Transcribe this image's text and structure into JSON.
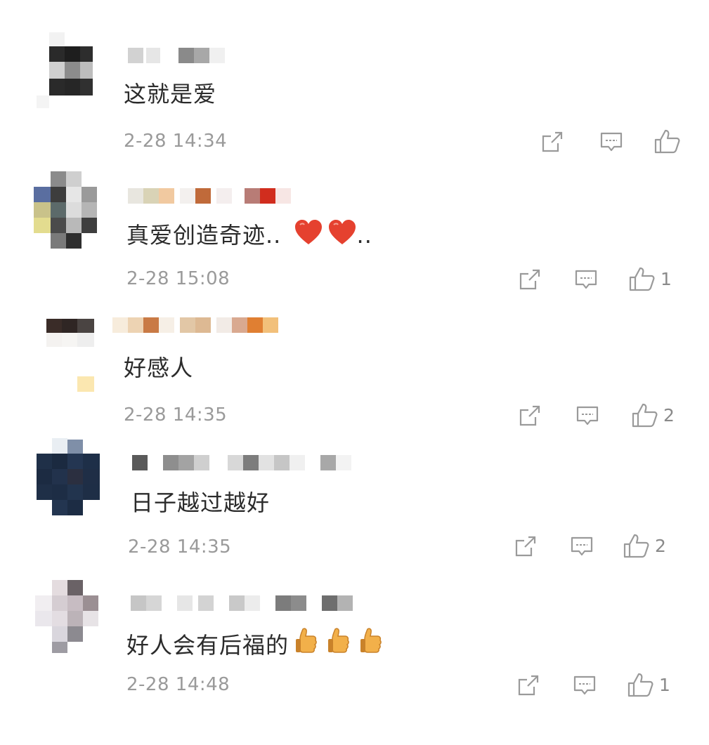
{
  "comments": [
    {
      "text": "这就是爱",
      "time": "2-28 14:34",
      "likes": "",
      "emoji": "",
      "emoji_count": 0
    },
    {
      "text": "真爱创造奇迹.. ",
      "time": "2-28 15:08",
      "likes": "1",
      "emoji": "red-heart",
      "emoji_count": 2,
      "suffix": ".."
    },
    {
      "text": "好感人",
      "time": "2-28 14:35",
      "likes": "2",
      "emoji": "",
      "emoji_count": 0
    },
    {
      "text": "日子越过越好",
      "time": "2-28 14:35",
      "likes": "2",
      "emoji": "",
      "emoji_count": 0
    },
    {
      "text": "好人会有后福的",
      "time": "2-28 14:48",
      "likes": "1",
      "emoji": "thumbs-up",
      "emoji_count": 3
    }
  ],
  "icons": {
    "share": "share-icon",
    "reply": "reply-icon",
    "like": "like-icon"
  },
  "colors": {
    "text": "#2b2b2b",
    "meta": "#9a9a9a",
    "heart": "#e5412f",
    "thumb": "#f2b04a"
  }
}
